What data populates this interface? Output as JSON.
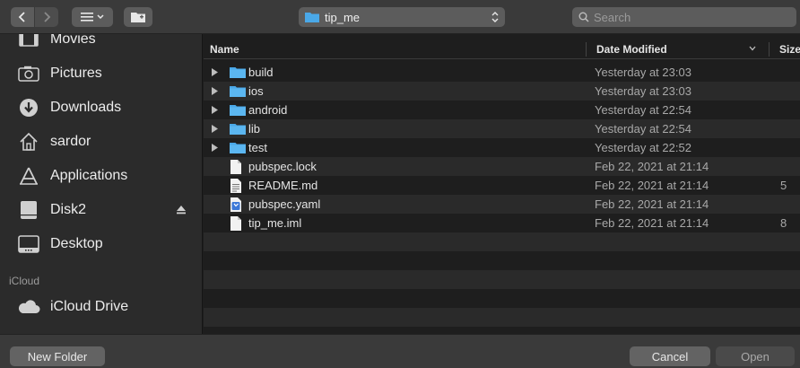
{
  "toolbar": {
    "path_label": "tip_me",
    "search_placeholder": "Search"
  },
  "sidebar": {
    "items": [
      {
        "label": "Movies",
        "icon": "film-icon"
      },
      {
        "label": "Pictures",
        "icon": "camera-icon"
      },
      {
        "label": "Downloads",
        "icon": "download-icon"
      },
      {
        "label": "sardor",
        "icon": "home-icon"
      },
      {
        "label": "Applications",
        "icon": "applications-icon"
      },
      {
        "label": "Disk2",
        "icon": "disk-icon"
      },
      {
        "label": "Desktop",
        "icon": "desktop-icon"
      }
    ],
    "icloud_header": "iCloud",
    "icloud_items": [
      {
        "label": "iCloud Drive",
        "icon": "cloud-icon"
      }
    ]
  },
  "columns": {
    "name": "Name",
    "date_modified": "Date Modified",
    "size": "Size"
  },
  "files": [
    {
      "name": "build",
      "date": "Yesterday at 23:03",
      "size": "",
      "kind": "folder"
    },
    {
      "name": "ios",
      "date": "Yesterday at 23:03",
      "size": "",
      "kind": "folder"
    },
    {
      "name": "android",
      "date": "Yesterday at 22:54",
      "size": "",
      "kind": "folder"
    },
    {
      "name": "lib",
      "date": "Yesterday at 22:54",
      "size": "",
      "kind": "folder"
    },
    {
      "name": "test",
      "date": "Yesterday at 22:52",
      "size": "",
      "kind": "folder"
    },
    {
      "name": "pubspec.lock",
      "date": "Feb 22, 2021 at 21:14",
      "size": "",
      "kind": "file"
    },
    {
      "name": "README.md",
      "date": "Feb 22, 2021 at 21:14",
      "size": "5",
      "kind": "text-file"
    },
    {
      "name": "pubspec.yaml",
      "date": "Feb 22, 2021 at 21:14",
      "size": "",
      "kind": "yaml-file"
    },
    {
      "name": "tip_me.iml",
      "date": "Feb 22, 2021 at 21:14",
      "size": "8",
      "kind": "file"
    }
  ],
  "buttons": {
    "new_folder": "New Folder",
    "cancel": "Cancel",
    "open": "Open"
  },
  "colors": {
    "folder_blue": "#4aa8e8",
    "background": "#1e1e1e",
    "sidebar": "#2b2b2b",
    "toolbar": "#3a3a3a"
  }
}
